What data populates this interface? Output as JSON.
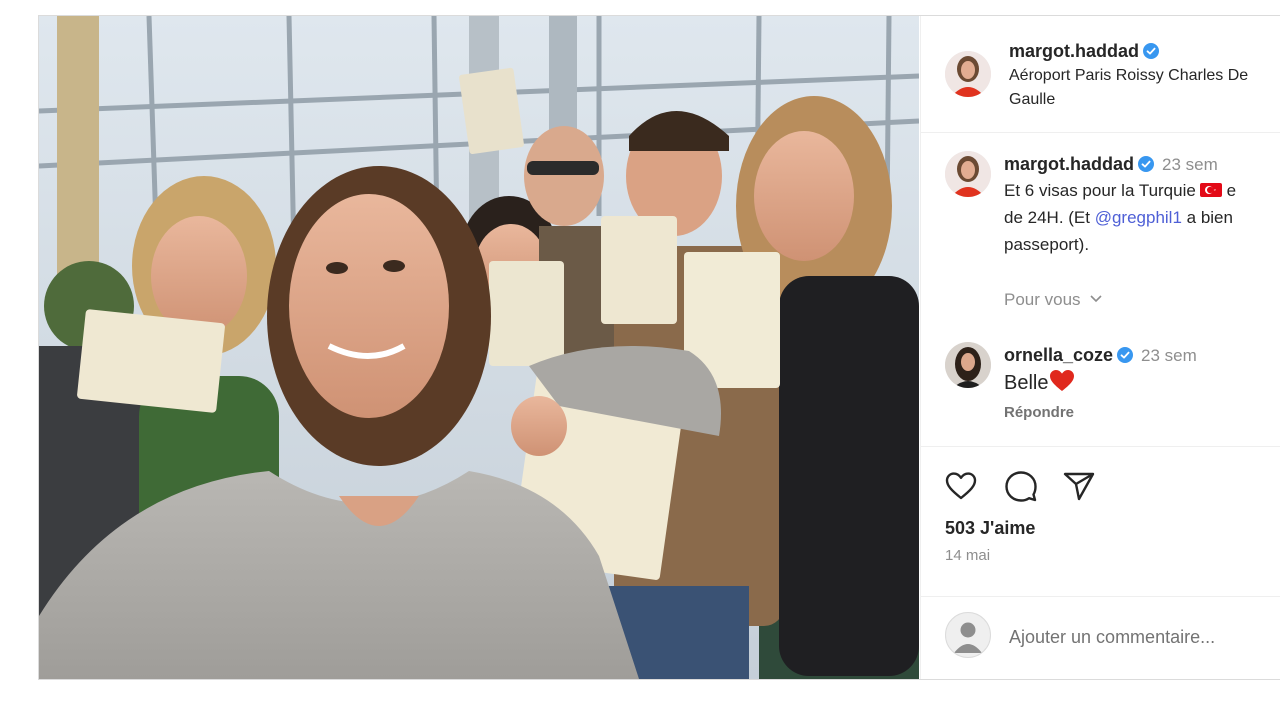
{
  "post": {
    "author": {
      "username": "margot.haddad",
      "verified": true,
      "location": "Aéroport Paris Roissy Charles De Gaulle"
    },
    "caption": {
      "username": "margot.haddad",
      "time": "23 sem",
      "line1_prefix": "Et 6 visas pour la Turquie",
      "line1_suffix": "e",
      "line2_prefix": "de 24H. (Et ",
      "mention": "@gregphil1",
      "line2_suffix": " a bien",
      "line3": "passeport)."
    },
    "for_you": "Pour vous",
    "comments": [
      {
        "username": "ornella_coze",
        "verified": true,
        "time": "23 sem",
        "text": "Belle",
        "emoji": "❤️",
        "reply_label": "Répondre"
      }
    ],
    "actions": {
      "like_icon": "heart-icon",
      "comment_icon": "comment-icon",
      "share_icon": "send-icon"
    },
    "likes": "503 J'aime",
    "date": "14 mai",
    "add_comment_placeholder": "Ajouter un commentaire..."
  },
  "colors": {
    "verified_blue": "#3897f0",
    "mention": "#4e5fd6",
    "like_heart": "#ed4956",
    "flag_red": "#e30a17"
  }
}
